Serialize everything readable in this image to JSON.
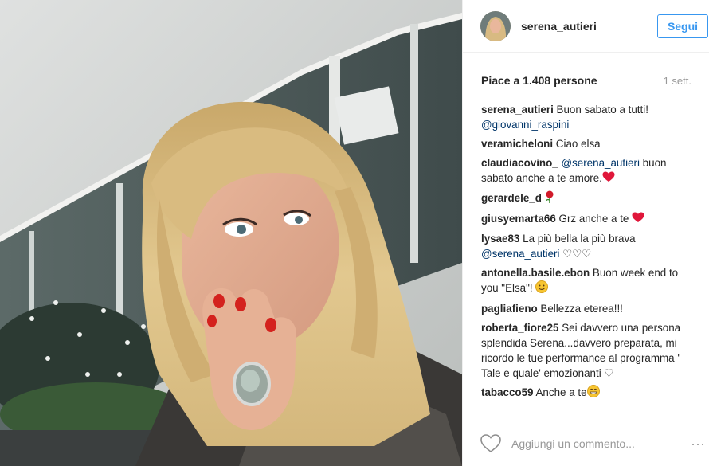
{
  "post": {
    "username": "serena_autieri",
    "follow_label": "Segui",
    "likes_text": "Piace a 1.408 persone",
    "time_text": "1 sett.",
    "add_comment_placeholder": "Aggiungi un commento...",
    "more_label": "···"
  },
  "comments": [
    {
      "user": "serena_autieri",
      "parts": [
        {
          "t": "Buon sabato a tutti! "
        },
        {
          "m": "@giovanni_raspini"
        }
      ]
    },
    {
      "user": "veramicheloni",
      "parts": [
        {
          "t": "Ciao elsa"
        }
      ]
    },
    {
      "user": "claudiacovino_",
      "parts": [
        {
          "m": "@serena_autieri"
        },
        {
          "t": " buon sabato anche a te amore."
        },
        {
          "e": "red-heart"
        }
      ]
    },
    {
      "user": "gerardele_d",
      "parts": [
        {
          "e": "rose"
        }
      ]
    },
    {
      "user": "giusyemarta66",
      "parts": [
        {
          "t": "Grz anche a te "
        },
        {
          "e": "red-heart"
        }
      ]
    },
    {
      "user": "lysae83",
      "parts": [
        {
          "t": "La più bella la più brava "
        },
        {
          "m": "@serena_autieri"
        },
        {
          "t": " ♡♡♡"
        }
      ]
    },
    {
      "user": "antonella.basile.ebon",
      "parts": [
        {
          "t": "Buon week end to you \"Elsa\"! "
        },
        {
          "e": "smile-face"
        }
      ]
    },
    {
      "user": "pagliafieno",
      "parts": [
        {
          "t": "Bellezza eterea!!!"
        }
      ]
    },
    {
      "user": "roberta_fiore25",
      "parts": [
        {
          "t": "Sei davvero una persona splendida Serena...davvero preparata, mi ricordo le tue performance al programma ' Tale e quale' emozionanti ♡"
        }
      ]
    },
    {
      "user": "tabacco59",
      "parts": [
        {
          "t": "Anche a te"
        },
        {
          "e": "grin-face"
        }
      ]
    }
  ],
  "icons": {
    "like": "heart-outline-icon",
    "more": "more-options-icon"
  },
  "colors": {
    "accent": "#3897f0",
    "mention": "#003569",
    "muted": "#999999",
    "heart": "#e0173a"
  }
}
